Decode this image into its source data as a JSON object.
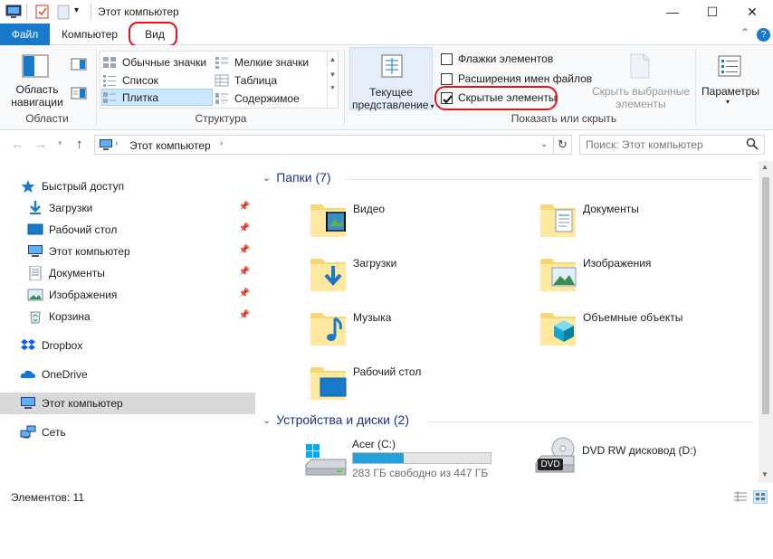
{
  "window": {
    "title": "Этот компьютер",
    "minimize_glyph": "—",
    "maximize_glyph": "☐",
    "close_glyph": "✕"
  },
  "tabs": {
    "file": "Файл",
    "computer": "Компьютер",
    "view": "Вид",
    "collapse_glyph": "⌃",
    "help_glyph": "?"
  },
  "ribbon": {
    "areas_group": {
      "label": "Области",
      "nav_pane_line1": "Область",
      "nav_pane_line2": "навигации"
    },
    "structure_group": {
      "label": "Структура",
      "items": [
        "Обычные значки",
        "Мелкие значки",
        "Список",
        "Таблица",
        "Плитка",
        "Содержимое"
      ],
      "selected": "Плитка"
    },
    "current_view": {
      "line1": "Текущее",
      "line2": "представление"
    },
    "show_hide_group": {
      "label": "Показать или скрыть",
      "item_checkboxes": "Флажки элементов",
      "item_checkboxes_checked": false,
      "file_extensions": "Расширения имен файлов",
      "file_extensions_checked": false,
      "hidden_items": "Скрытые элементы",
      "hidden_items_checked": true,
      "hide_selected_line1": "Скрыть выбранные",
      "hide_selected_line2": "элементы"
    },
    "parameters": "Параметры"
  },
  "address": {
    "path": "Этот компьютер",
    "search_placeholder": "Поиск: Этот компьютер"
  },
  "nav_pane": {
    "quick_access": "Быстрый доступ",
    "quick_items": [
      "Загрузки",
      "Рабочий стол",
      "Этот компьютер",
      "Документы",
      "Изображения",
      "Корзина"
    ],
    "dropbox": "Dropbox",
    "onedrive": "OneDrive",
    "this_pc": "Этот компьютер",
    "network": "Сеть"
  },
  "content": {
    "folders_header": "Папки (7)",
    "folders": [
      "Видео",
      "Документы",
      "Загрузки",
      "Изображения",
      "Музыка",
      "Объемные объекты",
      "Рабочий стол"
    ],
    "devices_header": "Устройства и диски (2)",
    "drive_c": {
      "name": "Acer (C:)",
      "free_text": "283 ГБ свободно из 447 ГБ",
      "used_fraction": 0.367
    },
    "drive_d": {
      "name": "DVD RW дисковод (D:)",
      "badge": "DVD"
    }
  },
  "status": {
    "items_count": "Элементов: 11"
  },
  "colors": {
    "accent": "#1979ca",
    "highlight_red": "#e8111b",
    "folder_yellow": "#f8d775",
    "section_blue": "#1e3287",
    "selected_nav": "#d9d9d9",
    "progress": "#26a0da"
  }
}
